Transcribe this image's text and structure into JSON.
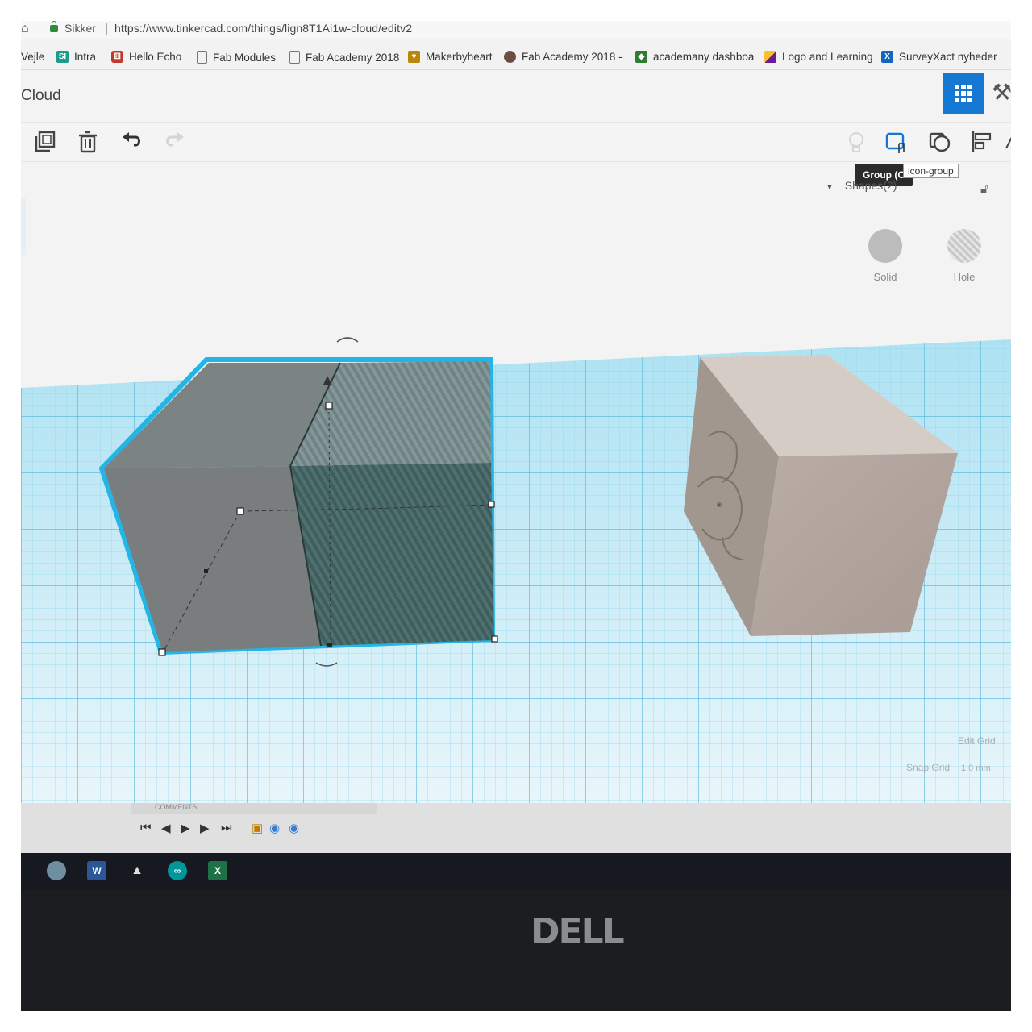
{
  "browser": {
    "secure_label": "Sikker",
    "url": "https://www.tinkercad.com/things/lign8T1Ai1w-cloud/editv2"
  },
  "bookmarks": [
    {
      "label": "Vejle",
      "icon": "none",
      "color": "#000000"
    },
    {
      "label": "Intra",
      "icon": "si-icon",
      "color": "#1c9c8c"
    },
    {
      "label": "Hello Echo",
      "icon": "dice-icon",
      "color": "#c0392b"
    },
    {
      "label": "Fab Modules",
      "icon": "page-icon",
      "color": "#888888"
    },
    {
      "label": "Fab Academy 2018",
      "icon": "page-icon",
      "color": "#888888"
    },
    {
      "label": "Makerbyheart",
      "icon": "makerbyheart-icon",
      "color": "#b8860b"
    },
    {
      "label": "Fab Academy 2018 -",
      "icon": "avatar-icon",
      "color": "#6d4c41"
    },
    {
      "label": "academany dashboa",
      "icon": "cube-icon",
      "color": "#2e7d32"
    },
    {
      "label": "Logo and Learning",
      "icon": "logo-icon",
      "color": "#6a1b9a"
    },
    {
      "label": "SurveyXact nyheder",
      "icon": "x-icon",
      "color": "#1565c0"
    }
  ],
  "app": {
    "title": "Cloud",
    "accent": "#1477d2"
  },
  "toolbar": {
    "tooltip": "Group (C",
    "hint": "icon-group"
  },
  "inspector": {
    "header": "Shapes(2)",
    "solid_label": "Solid",
    "hole_label": "Hole"
  },
  "workplane": {
    "edit_grid": "Edit Grid",
    "snap_label": "Snap Grid",
    "snap_value": "1.0 mm"
  },
  "background_app": {
    "comments_label": "COMMENTS"
  },
  "laptop": {
    "brand": "DELL"
  }
}
